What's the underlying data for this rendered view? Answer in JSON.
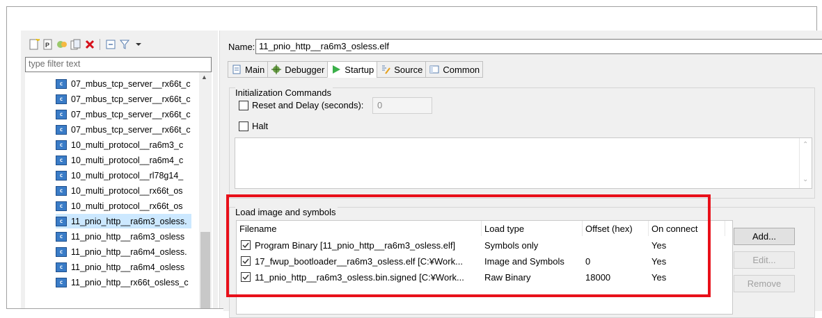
{
  "left": {
    "filter_placeholder": "type filter text",
    "items": [
      "07_mbus_tcp_server__rx66t_c",
      "07_mbus_tcp_server__rx66t_c",
      "07_mbus_tcp_server__rx66t_c",
      "07_mbus_tcp_server__rx66t_c",
      "10_multi_protocol__ra6m3_c",
      "10_multi_protocol__ra6m4_c",
      "10_multi_protocol__rl78g14_",
      "10_multi_protocol__rx66t_os",
      "10_multi_protocol__rx66t_os",
      "11_pnio_http__ra6m3_osless.",
      "11_pnio_http__ra6m3_osless",
      "11_pnio_http__ra6m4_osless.",
      "11_pnio_http__ra6m4_osless",
      "11_pnio_http__rx66t_osless_c"
    ],
    "selected_index": 9
  },
  "right": {
    "name_label": "Name:",
    "name_value": "11_pnio_http__ra6m3_osless.elf",
    "tabs": [
      "Main",
      "Debugger",
      "Startup",
      "Source",
      "Common"
    ],
    "init_group_title": "Initialization Commands",
    "reset_label": "Reset and Delay (seconds):",
    "reset_value": "0",
    "halt_label": "Halt",
    "load_group_title": "Load image and symbols",
    "table": {
      "headers": [
        "Filename",
        "Load type",
        "Offset (hex)",
        "On connect"
      ],
      "rows": [
        {
          "filename": "Program Binary [11_pnio_http__ra6m3_osless.elf]",
          "load_type": "Symbols only",
          "offset": "",
          "on_connect": "Yes"
        },
        {
          "filename": "17_fwup_bootloader__ra6m3_osless.elf [C:¥Work...",
          "load_type": "Image and Symbols",
          "offset": "0",
          "on_connect": "Yes"
        },
        {
          "filename": "11_pnio_http__ra6m3_osless.bin.signed [C:¥Work...",
          "load_type": "Raw Binary",
          "offset": "18000",
          "on_connect": "Yes"
        }
      ]
    },
    "buttons": {
      "add": "Add...",
      "edit": "Edit...",
      "remove": "Remove"
    }
  },
  "colors": {
    "highlight": "#e8101a",
    "selection": "#cce8ff",
    "c_file_icon": "#3a7cc7"
  }
}
